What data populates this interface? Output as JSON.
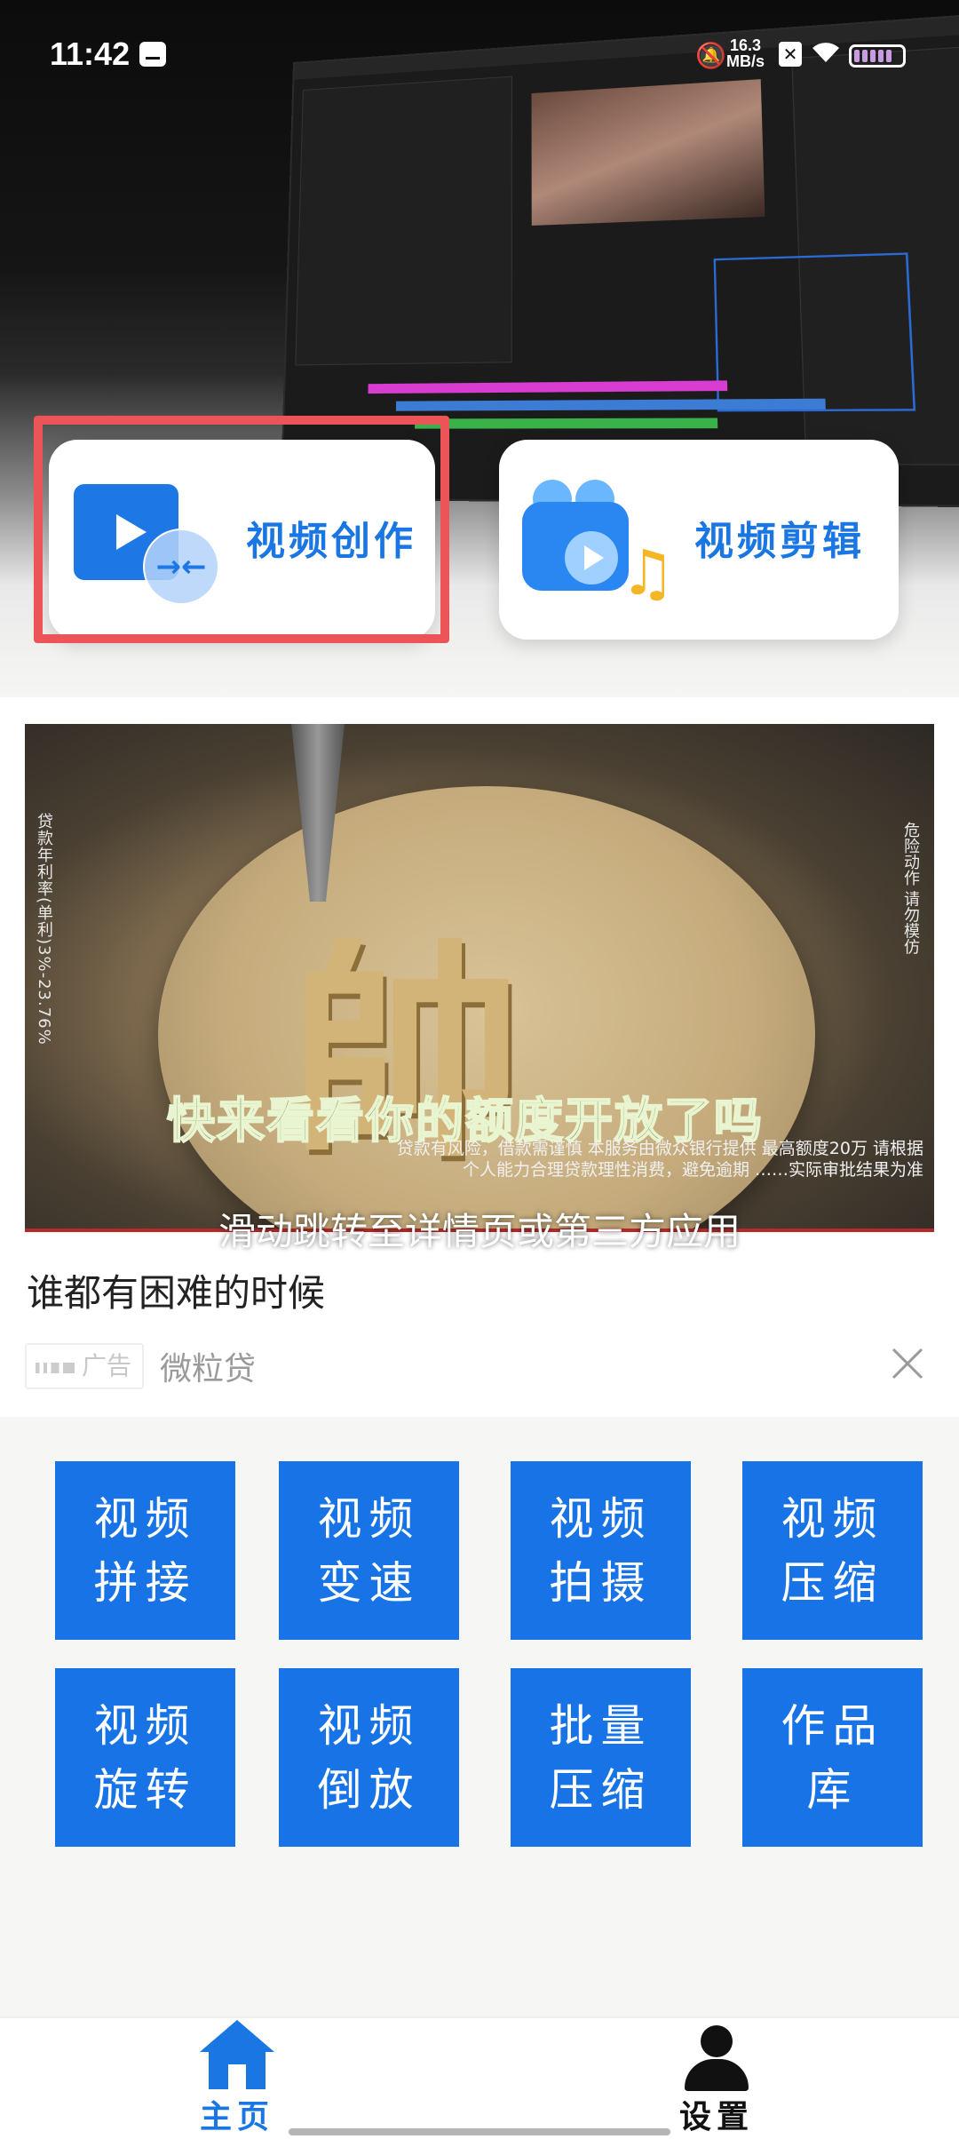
{
  "status_bar": {
    "time": "11:42",
    "speed_value": "16.3",
    "speed_unit": "MB/s"
  },
  "hero": {
    "create_label": "视频创作",
    "edit_label": "视频剪辑"
  },
  "ad": {
    "image_headline": "快来看看你的额度开放了吗",
    "side_text_left": "贷款年利率(单利)3%-23.76%",
    "side_text_right": "危险动作 请勿模仿",
    "disclaimer": "贷款有风险，借款需谨慎 本服务由微众银行提供 最高额度20万 请根据个人能力合理贷款理性消费，避免逾期 ……实际审批结果为准",
    "swipe_hint": "滑动跳转至详情页或第三方应用",
    "title": "谁都有困难的时候",
    "badge": "广告",
    "source": "微粒贷"
  },
  "tools": [
    {
      "label": "视频\n拼接"
    },
    {
      "label": "视频\n变速"
    },
    {
      "label": "视频\n拍摄"
    },
    {
      "label": "视频\n压缩"
    },
    {
      "label": "视频\n旋转"
    },
    {
      "label": "视频\n倒放"
    },
    {
      "label": "批量\n压缩"
    },
    {
      "label": "作品\n库"
    }
  ],
  "nav": {
    "home": "主页",
    "settings": "设置"
  },
  "colors": {
    "accent": "#1976e3",
    "tool_bg": "#1874e6",
    "highlight": "#ec5557"
  }
}
